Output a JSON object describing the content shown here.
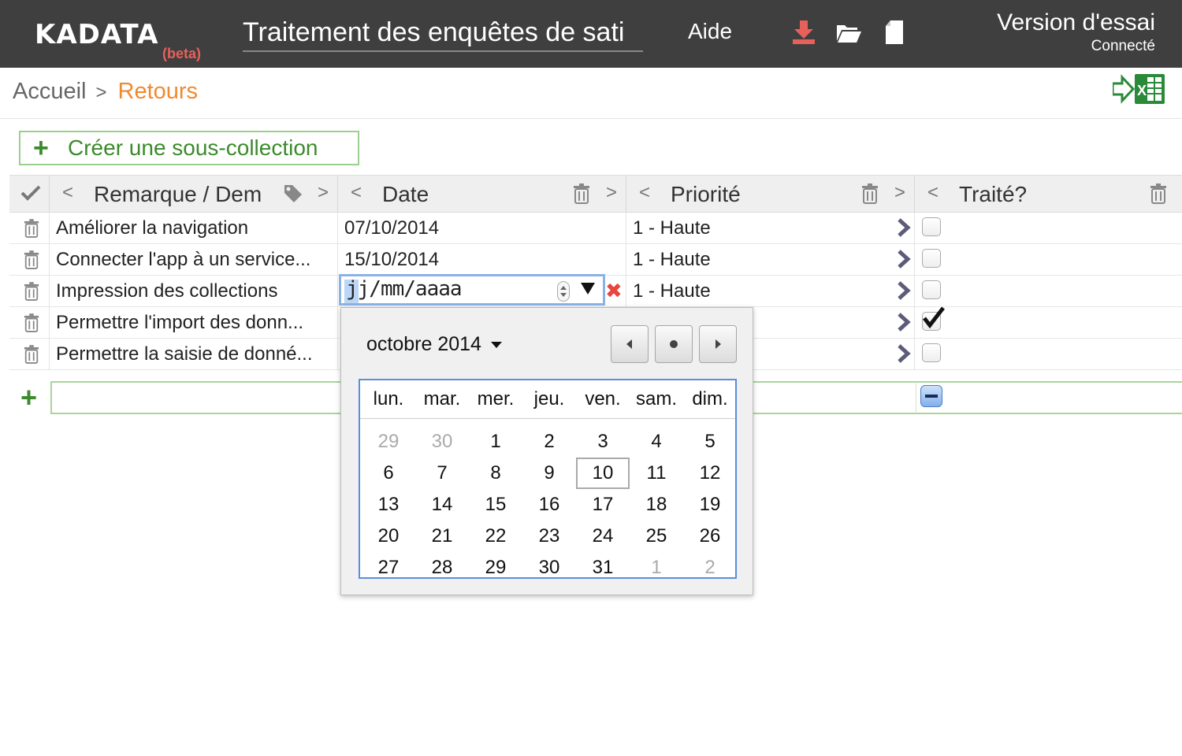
{
  "header": {
    "logo": "KADATA",
    "beta": "(beta)",
    "doc_title": "Traitement des enquêtes de sati",
    "help": "Aide",
    "icons": [
      "download-icon",
      "open-folder-icon",
      "new-file-icon"
    ],
    "version": "Version d'essai",
    "status": "Connecté"
  },
  "breadcrumb": {
    "home": "Accueil",
    "separator": ">",
    "current": "Retours"
  },
  "toolbar": {
    "create_plus": "+",
    "create_label": "Créer une sous-collection",
    "export_icon": "excel-export-icon"
  },
  "table": {
    "columns": [
      {
        "label": "Remarque / Dem",
        "left_arrow": "<",
        "right_arrow": ">"
      },
      {
        "label": "Date",
        "left_arrow": "<",
        "right_arrow": ">"
      },
      {
        "label": "Priorité",
        "left_arrow": "<",
        "right_arrow": ">"
      },
      {
        "label": "Traité?",
        "left_arrow": "<"
      }
    ],
    "rows": [
      {
        "remarque": "Améliorer la navigation",
        "date": "07/10/2014",
        "priorite": "1 - Haute",
        "traite": false
      },
      {
        "remarque": "Connecter l'app à un service...",
        "date": "15/10/2014",
        "priorite": "1 - Haute",
        "traite": false
      },
      {
        "remarque": "Impression des collections",
        "date": "",
        "priorite": "1 - Haute",
        "traite": false
      },
      {
        "remarque": "Permettre l'import des donn...",
        "date": "",
        "priorite": "",
        "traite": true
      },
      {
        "remarque": "Permettre la saisie de donné...",
        "date": "",
        "priorite": "",
        "traite": false
      }
    ],
    "new_row_plus": "+"
  },
  "date_editor": {
    "value": "jj/mm/aaaa",
    "clear": "✖"
  },
  "calendar": {
    "month_label": "octobre 2014",
    "weekdays": [
      "lun.",
      "mar.",
      "mer.",
      "jeu.",
      "ven.",
      "sam.",
      "dim."
    ],
    "weeks": [
      [
        "29",
        "30",
        "1",
        "2",
        "3",
        "4",
        "5"
      ],
      [
        "6",
        "7",
        "8",
        "9",
        "10",
        "11",
        "12"
      ],
      [
        "13",
        "14",
        "15",
        "16",
        "17",
        "18",
        "19"
      ],
      [
        "20",
        "21",
        "22",
        "23",
        "24",
        "25",
        "26"
      ],
      [
        "27",
        "28",
        "29",
        "30",
        "31",
        "1",
        "2"
      ]
    ],
    "other_month": [
      [
        0,
        0
      ],
      [
        0,
        1
      ],
      [
        4,
        5
      ],
      [
        4,
        6
      ]
    ],
    "today": [
      1,
      4
    ]
  },
  "colors": {
    "topbar": "#3f3f3f",
    "accent_orange": "#f0892f",
    "green": "#3c8a2c",
    "beta_red": "#e8605a",
    "calendar_border": "#5b8fd7"
  }
}
